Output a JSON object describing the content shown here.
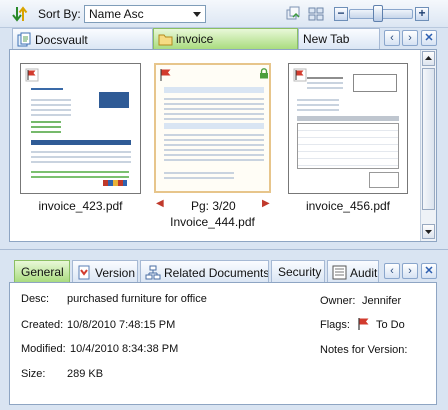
{
  "toolbar": {
    "sort_by_label": "Sort By:",
    "sort_value": "Name Asc",
    "zoom_out_label": "−",
    "zoom_in_label": "+",
    "zoom_level": 0.45
  },
  "doc_tabs": {
    "items": [
      {
        "label": "Docsvault",
        "icon": "docsvault-icon"
      },
      {
        "label": "invoice",
        "icon": "folder-icon"
      },
      {
        "label": "New Tab",
        "icon": ""
      }
    ],
    "active_index": 1
  },
  "thumbnails": [
    {
      "caption": "invoice_423.pdf"
    },
    {
      "caption": "Invoice_444.pdf",
      "page_indicator": "Pg: 3/20"
    },
    {
      "caption": "invoice_456.pdf"
    }
  ],
  "prop_tabs": {
    "items": [
      {
        "label": "General"
      },
      {
        "label": "Version"
      },
      {
        "label": "Related Documents"
      },
      {
        "label": "Security"
      },
      {
        "label": "Audit"
      }
    ],
    "active_index": 0
  },
  "details": {
    "desc_label": "Desc:",
    "desc_value": "purchased furniture for office",
    "created_label": "Created:",
    "created_value": "10/8/2010 7:48:15 PM",
    "modified_label": "Modified:",
    "modified_value": "10/4/2010 8:34:38 PM",
    "size_label": "Size:",
    "size_value": "289 KB",
    "owner_label": "Owner:",
    "owner_value": "Jennifer",
    "flags_label": "Flags:",
    "flags_value": "To Do",
    "notes_label": "Notes for Version:"
  },
  "colors": {
    "active_tab": "#a9dc7f",
    "flag_red": "#d23b2e",
    "accent_blue": "#2d5fb0"
  }
}
